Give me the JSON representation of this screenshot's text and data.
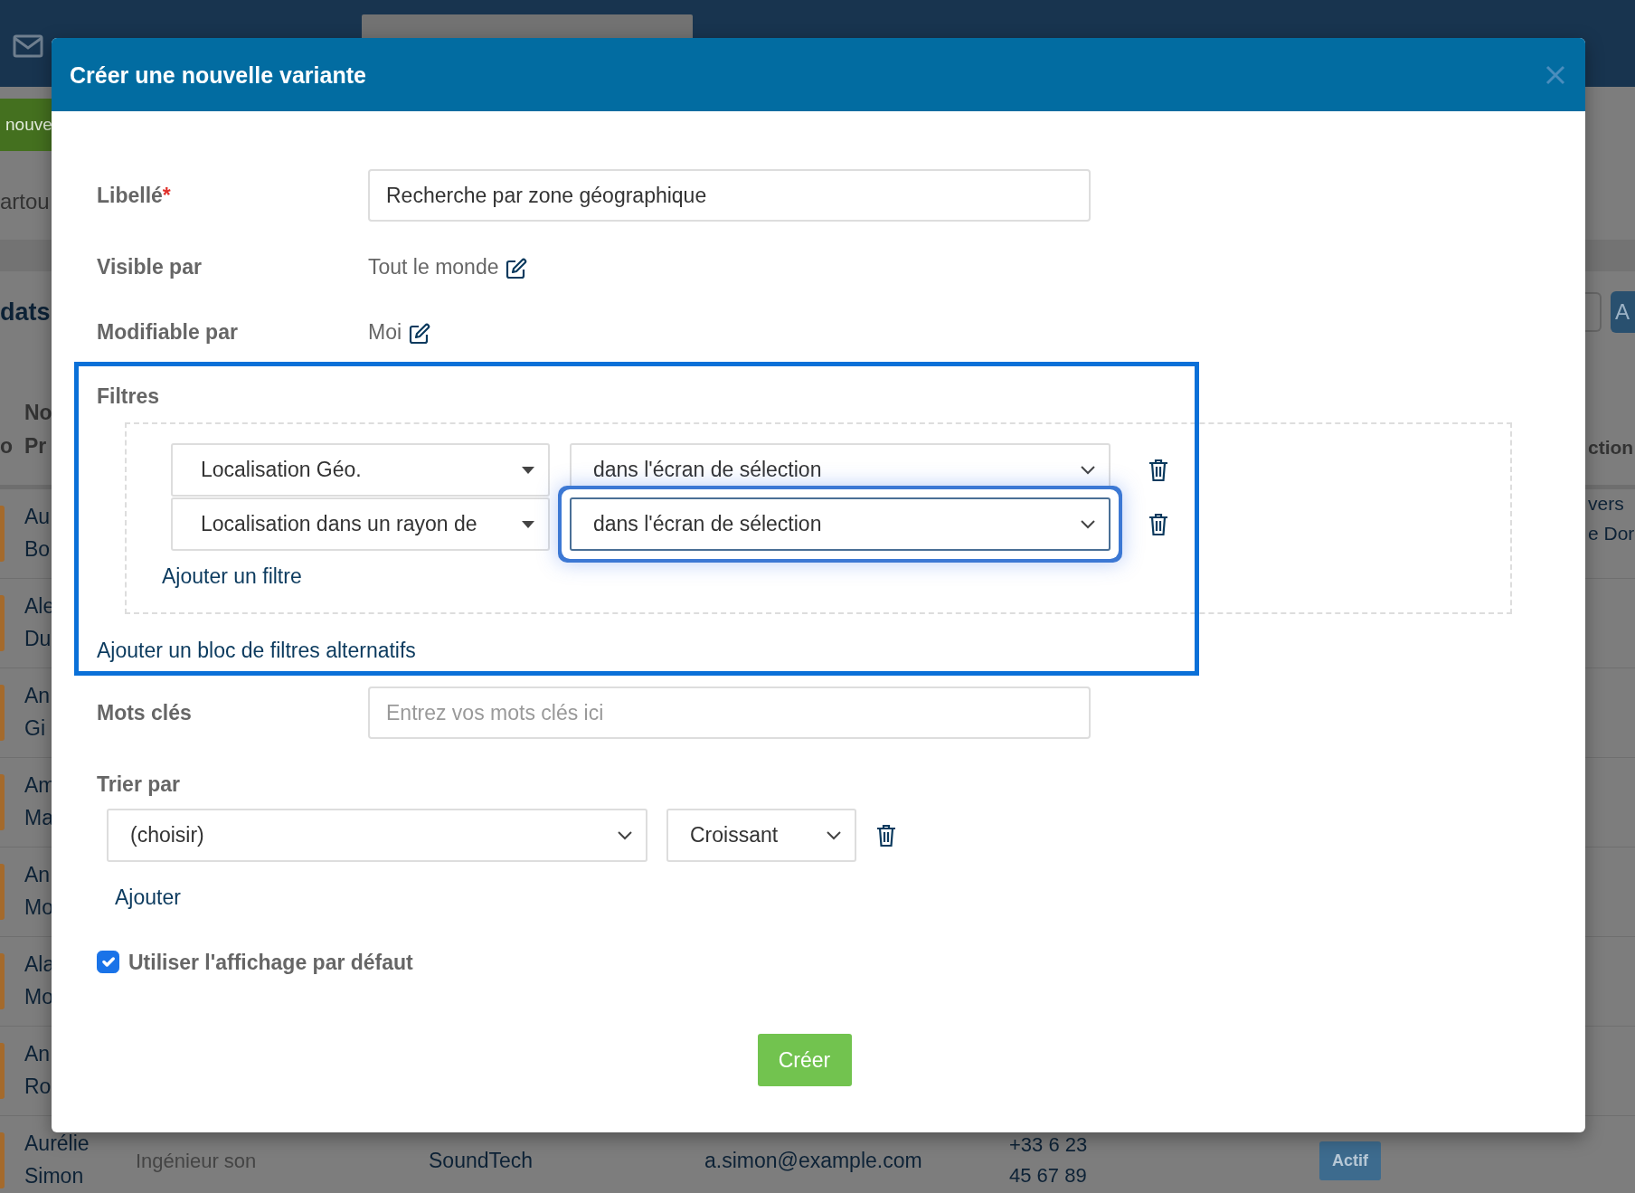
{
  "background_page": {
    "toolbar_button": "nouve",
    "breadcrumb": "artou",
    "heading": "dats",
    "right_button": "A",
    "table_header": {
      "left": "o",
      "column_fragment": [
        "No",
        "Pr"
      ],
      "right": "ction"
    },
    "rows": [
      {
        "name": [
          "Au",
          "Bo"
        ],
        "right": [
          "vers",
          "e Dor"
        ]
      },
      {
        "name": [
          "Ale",
          "Du"
        ]
      },
      {
        "name": [
          "An",
          "Gi"
        ]
      },
      {
        "name": [
          "Am",
          "Ma"
        ]
      },
      {
        "name": [
          "An",
          "Mo"
        ]
      },
      {
        "name": [
          "Ala",
          "Mo"
        ]
      },
      {
        "name": [
          "An",
          "Ro"
        ]
      },
      {
        "name": [
          "Aurélie",
          "Simon"
        ],
        "job": "Ingénieur son",
        "company": "SoundTech",
        "email": "a.simon@example.com",
        "phone": [
          "+33 6 23",
          "45 67 89"
        ],
        "status": "Actif"
      }
    ]
  },
  "dialog": {
    "title": "Créer une nouvelle variante",
    "fields": [
      {
        "kind": "input",
        "label": "Libellé",
        "required_mark": "*",
        "value": "Recherche par zone géographique"
      },
      {
        "kind": "text",
        "label": "Visible par",
        "value": "Tout le monde"
      },
      {
        "kind": "text",
        "label": "Modifiable par",
        "value": "Moi"
      }
    ],
    "filters": {
      "label": "Filtres",
      "highlighted": true,
      "rows": [
        {
          "field": "Localisation Géo.",
          "operator": "dans l'écran de sélection",
          "focused": false
        },
        {
          "field": "Localisation dans un rayon de",
          "operator": "dans l'écran de sélection",
          "focused": true
        }
      ],
      "add_filter_link": "Ajouter un filtre",
      "add_block_link": "Ajouter un bloc de filtres alternatifs"
    },
    "keywords": {
      "label": "Mots clés",
      "placeholder": "Entrez vos mots clés ici"
    },
    "sort": {
      "label": "Trier par",
      "field": "(choisir)",
      "order": "Croissant",
      "add_link": "Ajouter"
    },
    "default_display": {
      "label": "Utiliser l'affichage par défaut",
      "checked": true
    },
    "submit_button": "Créer"
  }
}
